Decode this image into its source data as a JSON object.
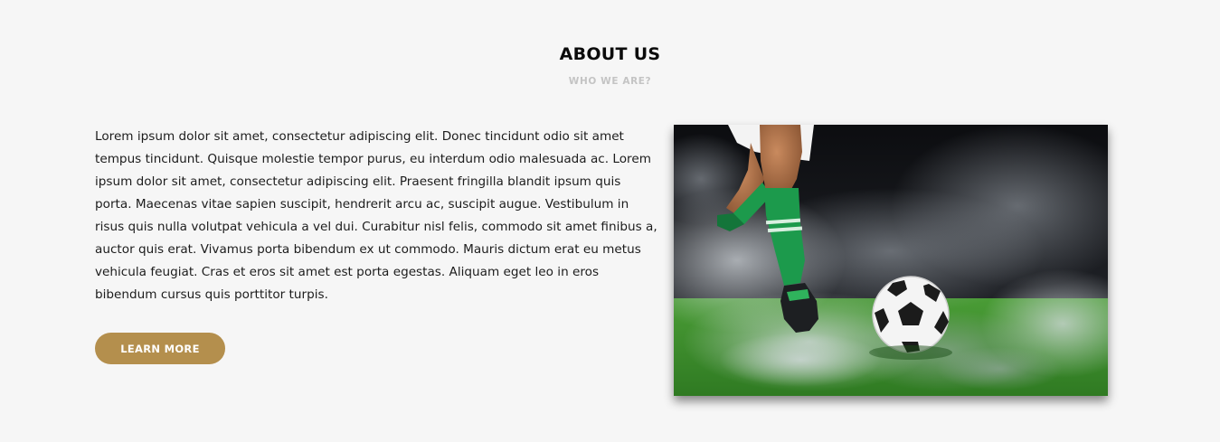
{
  "about": {
    "title": "ABOUT US",
    "subtitle": "WHO WE ARE?",
    "paragraph": "Lorem ipsum dolor sit amet, consectetur adipiscing elit. Donec tincidunt odio sit amet tempus tincidunt. Quisque molestie tempor purus, eu interdum odio malesuada ac. Lorem ipsum dolor sit amet, consectetur adipiscing elit. Praesent fringilla blandit ipsum quis porta. Maecenas vitae sapien suscipit, hendrerit arcu ac, suscipit augue. Vestibulum in risus quis nulla volutpat vehicula a vel dui. Curabitur nisl felis, commodo sit amet finibus a, auctor quis erat. Vivamus porta bibendum ex ut commodo. Mauris dictum erat eu metus vehicula feugiat. Cras et eros sit amet est porta egestas. Aliquam eget leo in eros bibendum cursus quis porttitor turpis.",
    "button_label": "LEARN MORE"
  },
  "colors": {
    "background": "#f6f6f6",
    "accent": "#b48f4d",
    "subtitle": "#c4c4c4",
    "grass": "#3f8f2c",
    "sock": "#1c9a4c"
  }
}
